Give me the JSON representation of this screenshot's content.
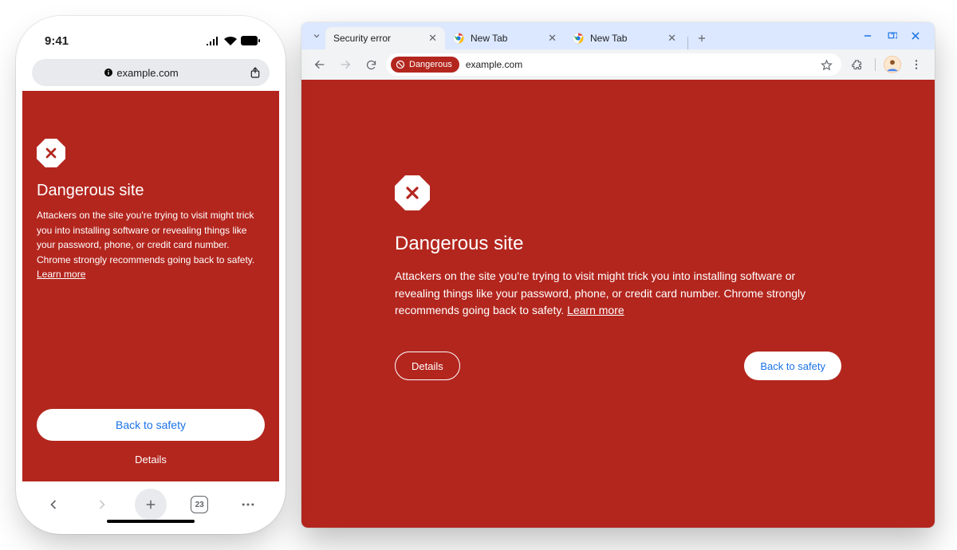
{
  "colors": {
    "danger": "#b3261e",
    "link": "#1a73e8"
  },
  "mobile": {
    "status": {
      "time": "9:41"
    },
    "address": {
      "host": "example.com"
    },
    "page": {
      "heading": "Dangerous site",
      "body": "Attackers on the site you're trying to visit might trick you into installing software or revealing things like your password, phone, or credit card number. Chrome strongly recommends going back to safety. ",
      "learn_more": "Learn more"
    },
    "actions": {
      "primary": "Back to safety",
      "secondary": "Details"
    },
    "bottombar": {
      "tab_count": "23"
    }
  },
  "desktop": {
    "tabs": [
      {
        "label": "Security error",
        "active": true
      },
      {
        "label": "New Tab",
        "active": false
      },
      {
        "label": "New Tab",
        "active": false
      }
    ],
    "toolbar": {
      "chip": "Dangerous",
      "host": "example.com"
    },
    "page": {
      "heading": "Dangerous site",
      "body": "Attackers on the site you're trying to visit might trick you into installing software or revealing things like your password, phone, or credit card number. Chrome strongly recommends going back to safety. ",
      "learn_more": "Learn more"
    },
    "actions": {
      "secondary": "Details",
      "primary": "Back to safety"
    }
  }
}
